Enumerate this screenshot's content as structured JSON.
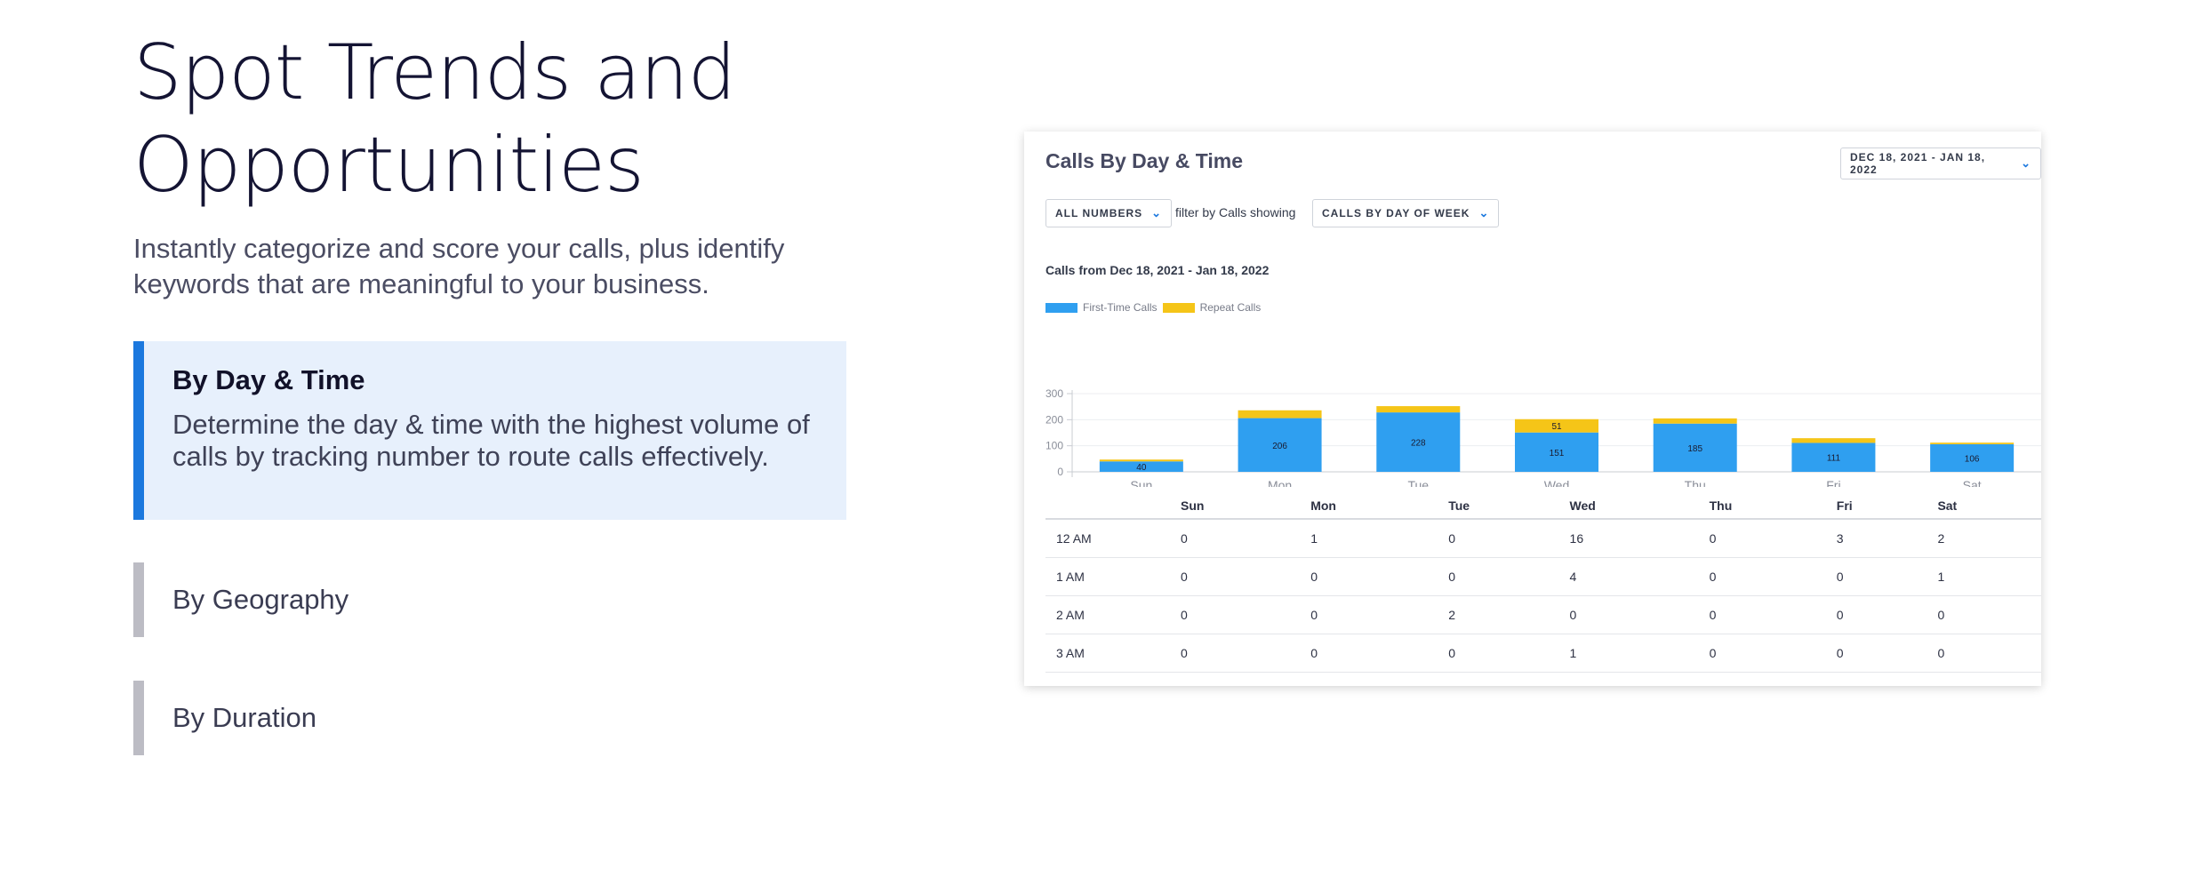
{
  "hero": {
    "title_line1": "Spot Trends and",
    "title_line2": "Opportunities",
    "subtitle": "Instantly categorize and score your calls, plus identify keywords that are meaningful to your business."
  },
  "tabs": [
    {
      "label": "By Day & Time",
      "description": "Determine the day & time with the highest volume of calls by tracking number to route calls effectively.",
      "active": true
    },
    {
      "label": "By Geography",
      "active": false
    },
    {
      "label": "By Duration",
      "active": false
    }
  ],
  "card": {
    "title": "Calls By Day & Time",
    "date_range": "DEC 18, 2021 - JAN 18, 2022",
    "numbers_filter": "ALL NUMBERS",
    "filter_text": "filter by Calls showing",
    "view_filter": "CALLS BY DAY OF WEEK",
    "calls_from": "Calls from Dec 18, 2021 - Jan 18, 2022"
  },
  "colors": {
    "first_time": "#2f9ff0",
    "repeat": "#f5c518",
    "accent": "#1b78de"
  },
  "chart_data": {
    "type": "bar",
    "stacked": true,
    "categories": [
      "Sun",
      "Mon",
      "Tue",
      "Wed",
      "Thu",
      "Fri",
      "Sat"
    ],
    "series": [
      {
        "name": "First-Time Calls",
        "values": [
          40,
          206,
          228,
          151,
          185,
          111,
          106
        ],
        "labels": [
          "40",
          "206",
          "228",
          "151",
          "185",
          "111",
          "106"
        ]
      },
      {
        "name": "Repeat Calls",
        "values": [
          7,
          30,
          24,
          51,
          20,
          18,
          6
        ],
        "labels": [
          "",
          "",
          "",
          "51",
          "",
          "",
          ""
        ]
      }
    ],
    "yticks": [
      "0",
      "100",
      "200",
      "300"
    ],
    "ylim": [
      0,
      300
    ],
    "grid": true,
    "legend": "top-left"
  },
  "table": {
    "headers": [
      "",
      "Sun",
      "Mon",
      "Tue",
      "Wed",
      "Thu",
      "Fri",
      "Sat"
    ],
    "rows": [
      [
        "12 AM",
        "0",
        "1",
        "0",
        "16",
        "0",
        "3",
        "2"
      ],
      [
        "1 AM",
        "0",
        "0",
        "0",
        "4",
        "0",
        "0",
        "1"
      ],
      [
        "2 AM",
        "0",
        "0",
        "2",
        "0",
        "0",
        "0",
        "0"
      ],
      [
        "3 AM",
        "0",
        "0",
        "0",
        "1",
        "0",
        "0",
        "0"
      ]
    ]
  }
}
